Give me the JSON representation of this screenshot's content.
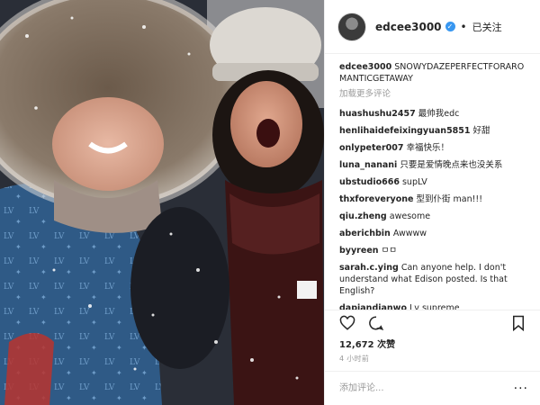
{
  "post": {
    "username": "edcee3000",
    "follow_status": "已关注",
    "separator": "•",
    "caption_text": "SNOWYDAZEPERFECTFORAROMANTICGETAWAY",
    "load_more": "加载更多评论",
    "comments": [
      {
        "user": "huashushu2457",
        "text": "最帅我edc"
      },
      {
        "user": "henlihaidefeixingyuan5851",
        "text": "好甜"
      },
      {
        "user": "onlypeter007",
        "text": "幸福快乐！"
      },
      {
        "user": "luna_nanani",
        "text": "只要是爱情晚点来也没关系"
      },
      {
        "user": "ubstudio666",
        "text": "supLV"
      },
      {
        "user": "thxforeveryone",
        "text": "型到仆街 man!!!"
      },
      {
        "user": "qiu.zheng",
        "text": "awesome"
      },
      {
        "user": "aberichbin",
        "text": "Awwww"
      },
      {
        "user": "byyreen",
        "text": "ㅁㅁ"
      },
      {
        "user": "sarah.c.ying",
        "text": "Can anyone help. I don't understand what Edison posted. Is that English?"
      },
      {
        "user": "dapiandianwo",
        "text": "Lv supreme"
      }
    ],
    "likes": "12,672 次赞",
    "time_ago": "4 小时前",
    "add_comment_placeholder": "添加评论...",
    "more_label": "···"
  },
  "icons": {
    "like": "heart-icon",
    "comment": "comment-bubble-icon",
    "save": "bookmark-icon",
    "verified": "verified-badge-icon",
    "more": "more-options-icon"
  },
  "colors": {
    "verified": "#3897f0",
    "muted": "#999999",
    "text": "#262626"
  }
}
